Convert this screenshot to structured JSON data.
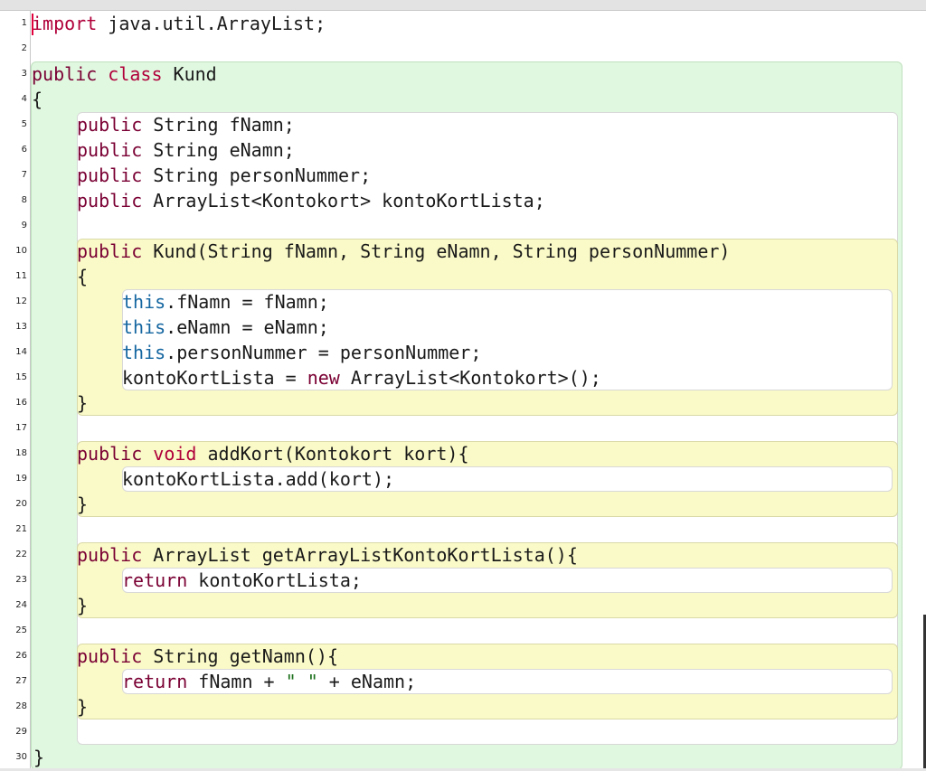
{
  "editor": {
    "line_numbers": [
      "1",
      "2",
      "3",
      "4",
      "5",
      "6",
      "7",
      "8",
      "9",
      "10",
      "11",
      "12",
      "13",
      "14",
      "15",
      "16",
      "17",
      "18",
      "19",
      "20",
      "21",
      "22",
      "23",
      "24",
      "25",
      "26",
      "27",
      "28",
      "29",
      "30"
    ],
    "lines": [
      [
        {
          "t": "import",
          "c": "kw2"
        },
        {
          "t": " java.util.ArrayList;",
          "c": ""
        }
      ],
      [],
      [
        {
          "t": "public",
          "c": "kw"
        },
        {
          "t": " ",
          "c": ""
        },
        {
          "t": "class",
          "c": "kw2"
        },
        {
          "t": " Kund",
          "c": ""
        }
      ],
      [
        {
          "t": "{",
          "c": ""
        }
      ],
      [
        {
          "t": "public",
          "c": "kw"
        },
        {
          "t": " String fNamn;",
          "c": ""
        }
      ],
      [
        {
          "t": "public",
          "c": "kw"
        },
        {
          "t": " String eNamn;",
          "c": ""
        }
      ],
      [
        {
          "t": "public",
          "c": "kw"
        },
        {
          "t": " String personNummer;",
          "c": ""
        }
      ],
      [
        {
          "t": "public",
          "c": "kw"
        },
        {
          "t": " ArrayList<Kontokort> kontoKortLista;",
          "c": ""
        }
      ],
      [],
      [
        {
          "t": "public",
          "c": "kw"
        },
        {
          "t": " Kund(String fNamn, String eNamn, String personNummer)",
          "c": ""
        }
      ],
      [
        {
          "t": "{",
          "c": ""
        }
      ],
      [
        {
          "t": "this",
          "c": "th"
        },
        {
          "t": ".fNamn = fNamn;",
          "c": ""
        }
      ],
      [
        {
          "t": "this",
          "c": "th"
        },
        {
          "t": ".eNamn = eNamn;",
          "c": ""
        }
      ],
      [
        {
          "t": "this",
          "c": "th"
        },
        {
          "t": ".personNummer = personNummer;",
          "c": ""
        }
      ],
      [
        {
          "t": "kontoKortLista = ",
          "c": ""
        },
        {
          "t": "new",
          "c": "kw"
        },
        {
          "t": " ArrayList<Kontokort>();",
          "c": ""
        }
      ],
      [
        {
          "t": "}",
          "c": ""
        }
      ],
      [],
      [
        {
          "t": "public",
          "c": "kw"
        },
        {
          "t": " ",
          "c": ""
        },
        {
          "t": "void",
          "c": "kw2"
        },
        {
          "t": " addKort(Kontokort kort){",
          "c": ""
        }
      ],
      [
        {
          "t": "kontoKortLista.add(kort);",
          "c": ""
        }
      ],
      [
        {
          "t": "}",
          "c": ""
        }
      ],
      [],
      [
        {
          "t": "public",
          "c": "kw"
        },
        {
          "t": " ArrayList getArrayListKontoKortLista(){",
          "c": ""
        }
      ],
      [
        {
          "t": "return",
          "c": "kw"
        },
        {
          "t": " kontoKortLista;",
          "c": ""
        }
      ],
      [
        {
          "t": "}",
          "c": ""
        }
      ],
      [],
      [
        {
          "t": "public",
          "c": "kw"
        },
        {
          "t": " String getNamn(){",
          "c": ""
        }
      ],
      [
        {
          "t": "return",
          "c": "kw"
        },
        {
          "t": " fNamn + ",
          "c": ""
        },
        {
          "t": "\" \"",
          "c": "str"
        },
        {
          "t": " + eNamn;",
          "c": ""
        }
      ],
      [
        {
          "t": "}",
          "c": ""
        }
      ],
      [],
      [
        {
          "t": "}",
          "c": ""
        }
      ]
    ]
  },
  "colors": {
    "class_block": "#e0f7e0",
    "method_block": "#fafac8",
    "body_block": "#ffffff",
    "keyword": "#7a0033",
    "keyword_strong": "#b0003a",
    "this_keyword": "#1466a0"
  }
}
